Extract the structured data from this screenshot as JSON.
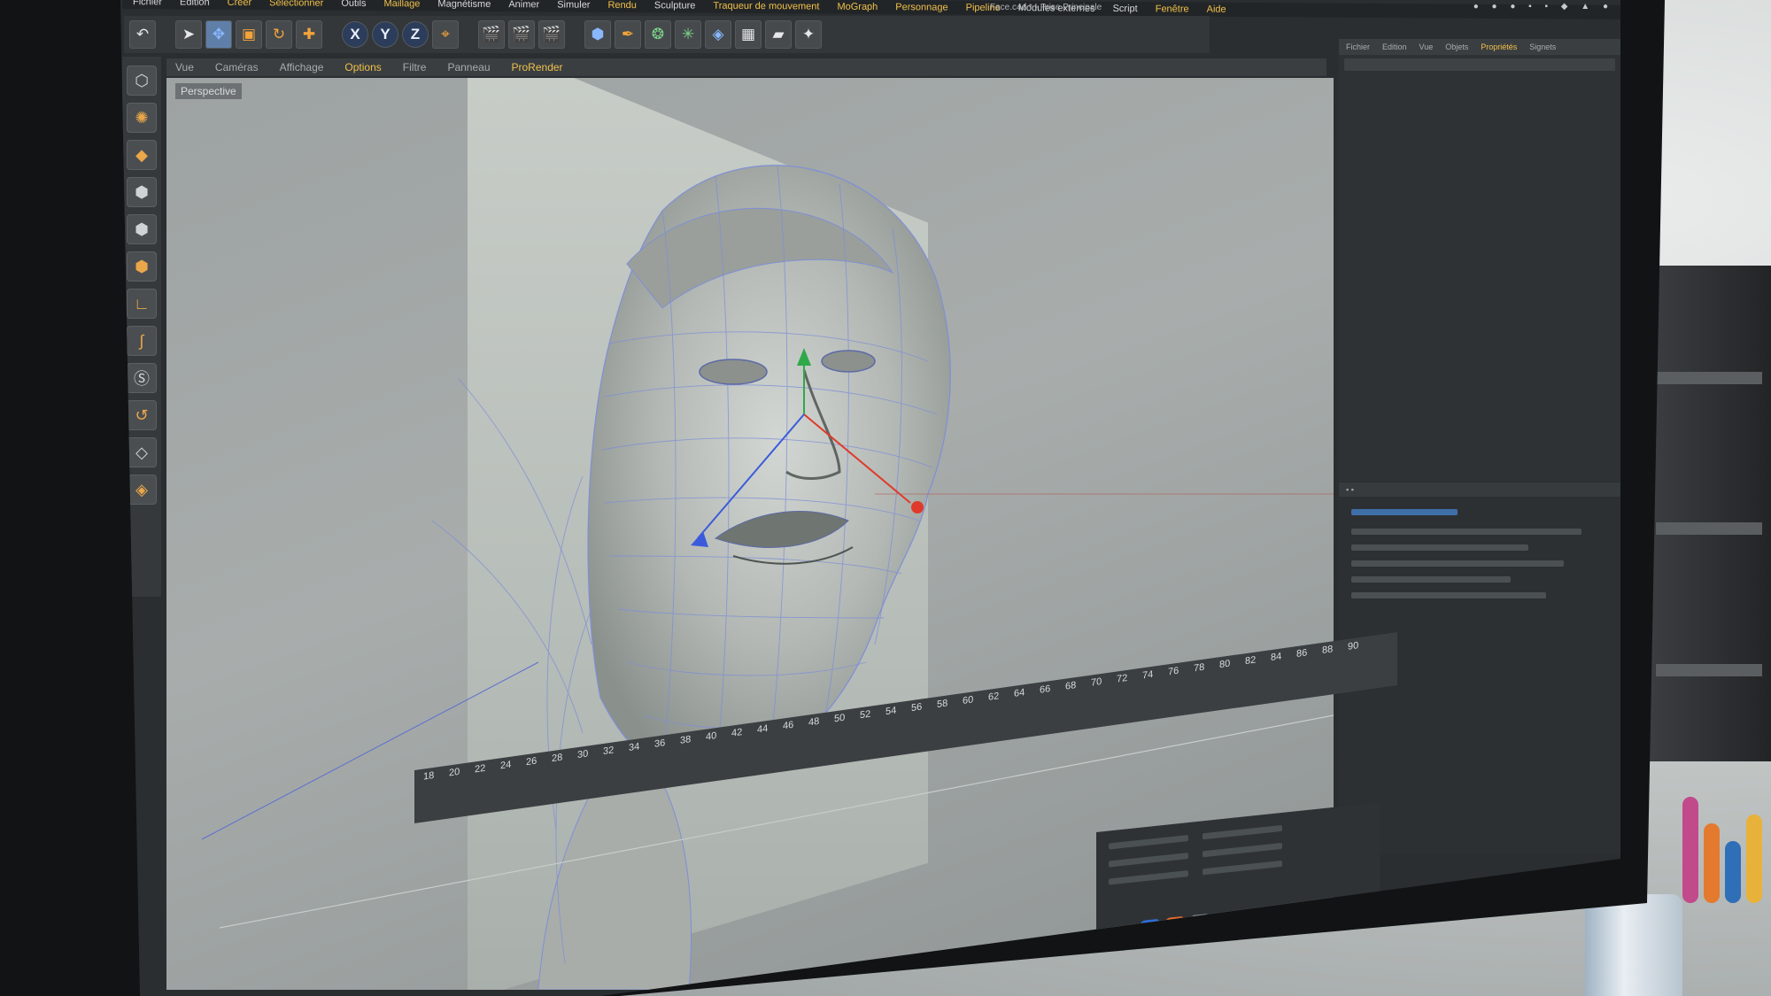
{
  "app": {
    "window_title": "Face.c4d * - Prise Principale"
  },
  "menu": {
    "items": [
      "Fichier",
      "Edition",
      "Créer",
      "Sélectionner",
      "Outils",
      "Maillage",
      "Magnétisme",
      "Animer",
      "Simuler",
      "Rendu",
      "Sculpture",
      "Traqueur de mouvement",
      "MoGraph",
      "Personnage",
      "Pipeline",
      "Modules externes",
      "Script",
      "Fenêtre",
      "Aide"
    ]
  },
  "toolbar": {
    "axis_x": "X",
    "axis_y": "Y",
    "axis_z": "Z"
  },
  "viewport": {
    "menu": [
      "Vue",
      "Caméras",
      "Affichage",
      "Options",
      "Filtre",
      "Panneau",
      "ProRender"
    ],
    "active_menu": "Options",
    "label": "Perspective"
  },
  "object_manager": {
    "tabs": [
      "Fichier",
      "Edition",
      "Vue",
      "Objets",
      "Propriétés",
      "Signets"
    ]
  },
  "timeline": {
    "frames": [
      "18",
      "20",
      "22",
      "24",
      "26",
      "28",
      "30",
      "32",
      "34",
      "36",
      "38",
      "40",
      "42",
      "44",
      "46",
      "48",
      "50",
      "52",
      "54",
      "56",
      "58",
      "60",
      "62",
      "64",
      "66",
      "68",
      "70",
      "72",
      "74",
      "76",
      "78",
      "80",
      "82",
      "84",
      "86",
      "88",
      "90"
    ]
  },
  "palette": {
    "tool_icons": [
      "cube-icon",
      "sphere-icon",
      "plane-icon",
      "cube-icon",
      "cube-icon",
      "cube-icon",
      "corner-icon",
      "spline-icon",
      "s-icon",
      "bend-icon",
      "floor-icon",
      "light-icon"
    ]
  },
  "colors": {
    "accent": "#f0c04a",
    "wireframe": "#7f8fd6",
    "axis_x": "#e0392b",
    "axis_y": "#2fa84a",
    "axis_z": "#3b5bdc"
  }
}
